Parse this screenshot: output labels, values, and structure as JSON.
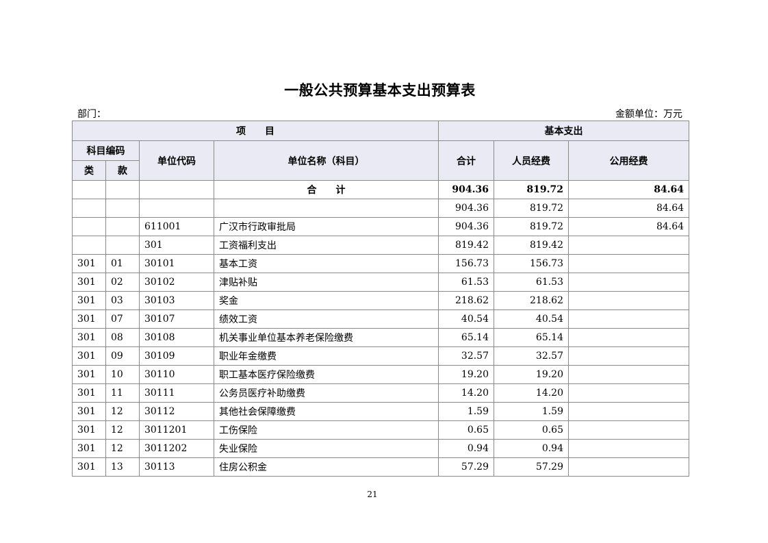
{
  "title": "一般公共预算基本支出预算表",
  "dept_label": "部门：",
  "unit_label": "金额单位：万元",
  "header": {
    "project": "项　　目",
    "basic_expense": "基本支出",
    "subject_code": "科目编码",
    "category": "类",
    "item": "款",
    "unit_code": "单位代码",
    "unit_name": "单位名称（科目）",
    "total": "合计",
    "personnel": "人员经费",
    "public": "公用经费"
  },
  "total_row": {
    "label": "合　　计",
    "total": "904.36",
    "personnel": "819.72",
    "public": "84.64"
  },
  "rows": [
    {
      "cat": "",
      "item": "",
      "code": "",
      "name": "",
      "total": "904.36",
      "personnel": "819.72",
      "public": "84.64"
    },
    {
      "cat": "",
      "item": "",
      "code": "611001",
      "name": "广汉市行政审批局",
      "total": "904.36",
      "personnel": "819.72",
      "public": "84.64"
    },
    {
      "cat": "",
      "item": "",
      "code": "301",
      "name": "工资福利支出",
      "total": "819.42",
      "personnel": "819.42",
      "public": ""
    },
    {
      "cat": "301",
      "item": "01",
      "code": "30101",
      "name": "基本工资",
      "total": "156.73",
      "personnel": "156.73",
      "public": ""
    },
    {
      "cat": "301",
      "item": "02",
      "code": "30102",
      "name": "津贴补贴",
      "total": "61.53",
      "personnel": "61.53",
      "public": ""
    },
    {
      "cat": "301",
      "item": "03",
      "code": "30103",
      "name": "奖金",
      "total": "218.62",
      "personnel": "218.62",
      "public": ""
    },
    {
      "cat": "301",
      "item": "07",
      "code": "30107",
      "name": "绩效工资",
      "total": "40.54",
      "personnel": "40.54",
      "public": ""
    },
    {
      "cat": "301",
      "item": "08",
      "code": "30108",
      "name": "机关事业单位基本养老保险缴费",
      "total": "65.14",
      "personnel": "65.14",
      "public": ""
    },
    {
      "cat": "301",
      "item": "09",
      "code": "30109",
      "name": "职业年金缴费",
      "total": "32.57",
      "personnel": "32.57",
      "public": ""
    },
    {
      "cat": "301",
      "item": "10",
      "code": "30110",
      "name": "职工基本医疗保险缴费",
      "total": "19.20",
      "personnel": "19.20",
      "public": ""
    },
    {
      "cat": "301",
      "item": "11",
      "code": "30111",
      "name": "公务员医疗补助缴费",
      "total": "14.20",
      "personnel": "14.20",
      "public": ""
    },
    {
      "cat": "301",
      "item": "12",
      "code": "30112",
      "name": "其他社会保障缴费",
      "total": "1.59",
      "personnel": "1.59",
      "public": ""
    },
    {
      "cat": "301",
      "item": "12",
      "code": "3011201",
      "name": "工伤保险",
      "total": "0.65",
      "personnel": "0.65",
      "public": ""
    },
    {
      "cat": "301",
      "item": "12",
      "code": "3011202",
      "name": "失业保险",
      "total": "0.94",
      "personnel": "0.94",
      "public": ""
    },
    {
      "cat": "301",
      "item": "13",
      "code": "30113",
      "name": "住房公积金",
      "total": "57.29",
      "personnel": "57.29",
      "public": ""
    }
  ],
  "page_number": "21"
}
